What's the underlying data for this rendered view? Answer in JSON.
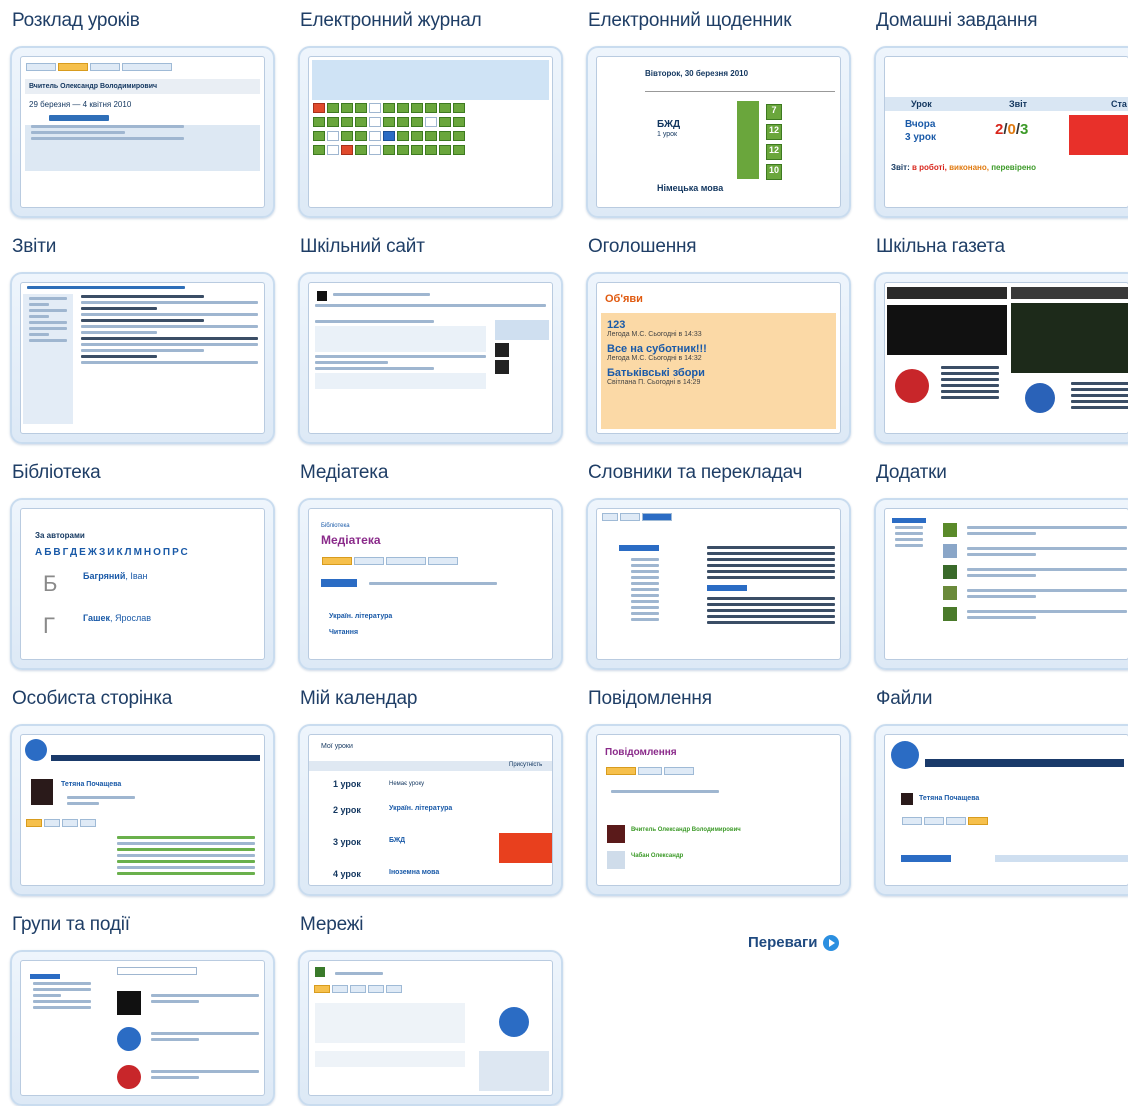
{
  "tiles": [
    {
      "title": "Розклад уроків"
    },
    {
      "title": "Електронний журнал"
    },
    {
      "title": "Електронний щоденник"
    },
    {
      "title": "Домашні завдання"
    },
    {
      "title": "Звіти"
    },
    {
      "title": "Шкільний сайт"
    },
    {
      "title": "Оголошення"
    },
    {
      "title": "Шкільна газета"
    },
    {
      "title": "Бібліотека"
    },
    {
      "title": "Медіатека"
    },
    {
      "title": "Словники та перекладач"
    },
    {
      "title": "Додатки"
    },
    {
      "title": "Особиста сторінка"
    },
    {
      "title": "Мій календар"
    },
    {
      "title": "Повідомлення"
    },
    {
      "title": "Файли"
    },
    {
      "title": "Групи та події"
    },
    {
      "title": "Мережі"
    }
  ],
  "previews": {
    "schedule": {
      "date_range": "29 березня — 4 квітня 2010",
      "teacher": "Вчитель Олександр Володимирович"
    },
    "diary": {
      "date": "Вівторок, 30 березня 2010",
      "subject1": "БЖД",
      "lesson1": "1 урок",
      "subject2": "Німецька мова",
      "grades": [
        "7",
        "12",
        "12",
        "10"
      ]
    },
    "homework": {
      "col1": "Урок",
      "col2": "Звіт",
      "col3": "Ста",
      "when": "Вчора",
      "lesson": "3 урок",
      "score_a": "2",
      "score_b": "0",
      "score_c": "3",
      "status_label": "Звіт:",
      "status_work": "в роботі,",
      "status_done": "виконано,",
      "status_checked": "перевірено"
    },
    "announcements": {
      "header": "Об'яви",
      "items": [
        {
          "title": "123",
          "meta": "Легода М.С. Сьогодні в 14:33"
        },
        {
          "title": "Все на суботник!!!",
          "meta": "Легода М.С. Сьогодні в 14:32"
        },
        {
          "title": "Батьківські збори",
          "meta": "Світлана П. Сьогодні в 14:29"
        }
      ]
    },
    "library": {
      "by_authors": "За авторами",
      "alphabet": "АБВГДЕЖЗИКЛМНОПРС",
      "letter1": "Б",
      "author1_last": "Багряний",
      "author1_first": ", Іван",
      "letter2": "Г",
      "author2_last": "Гашек",
      "author2_first": ", Ярослав"
    },
    "mediateka": {
      "crumb": "Бібліотека",
      "title": "Медіатека",
      "row1": "Україн. література",
      "row2": "Читання"
    },
    "calendar": {
      "title": "Мої уроки",
      "col": "Присутність",
      "lessons": [
        {
          "n": "1 урок",
          "subject": "Немає уроку"
        },
        {
          "n": "2 урок",
          "subject": "Україн. література"
        },
        {
          "n": "3 урок",
          "subject": "БЖД"
        },
        {
          "n": "4 урок",
          "subject": "Іноземна мова"
        }
      ]
    },
    "messages": {
      "title": "Повідомлення",
      "sender1": "Вчитель Олександр Володимирович",
      "sender2": "Чабан Олександр"
    },
    "personal": {
      "name": "Тетяна Почащева"
    },
    "files": {
      "name": "Тетяна Почащева"
    }
  },
  "more_link": {
    "label": "Переваги"
  }
}
